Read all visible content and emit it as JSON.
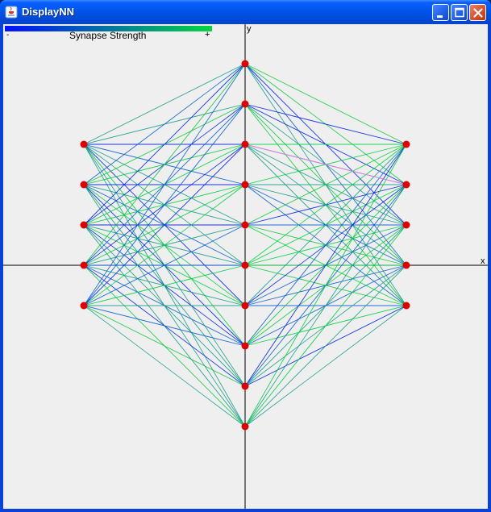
{
  "window": {
    "title": "DisplayNN",
    "icon": "java-cup-icon",
    "controls": [
      "minimize-icon",
      "maximize-icon",
      "close-icon"
    ]
  },
  "legend": {
    "minus": "-",
    "label": "Synapse Strength",
    "plus": "+",
    "colors": [
      "#0010ff",
      "#00d840"
    ]
  },
  "axes": {
    "x_label": "x",
    "y_label": "y"
  },
  "network": {
    "node_color": "#dd0000",
    "layers": [
      {
        "name": "left",
        "node_count": 5
      },
      {
        "name": "center",
        "node_count": 10
      },
      {
        "name": "right",
        "node_count": 5
      }
    ],
    "edge_colors": [
      "#0022dd",
      "#0a5fd0",
      "#1a9f8a",
      "#13c840",
      "#00d040"
    ],
    "highlight_edge_color": "#e080e0"
  }
}
